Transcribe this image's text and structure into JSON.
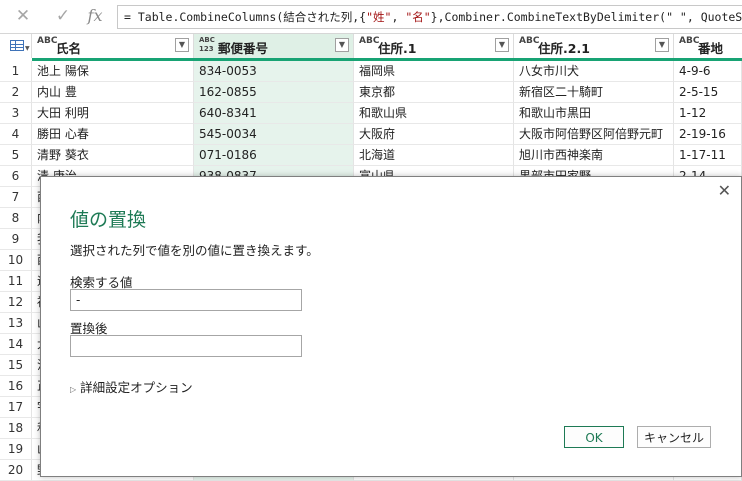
{
  "formula": {
    "prefix": "= Table.CombineColumns(結合された列,{",
    "str1": "\"姓\"",
    "sep": ", ",
    "str2": "\"名\"",
    "suffix": "},Combiner.CombineTextByDelimiter(\" \", QuoteStyle.None),\"氏名\")",
    "icons": [
      "close-icon",
      "check-icon",
      "fx-icon"
    ]
  },
  "columns": [
    {
      "type": "ABC",
      "title": "氏名"
    },
    {
      "type": "ABC 123",
      "title": "郵便番号"
    },
    {
      "type": "ABC",
      "title": "住所.1"
    },
    {
      "type": "ABC",
      "title": "住所.2.1"
    },
    {
      "type": "ABC",
      "title": "番地"
    }
  ],
  "rows": [
    {
      "n": "1",
      "c": [
        "池上 陽保",
        "834-0053",
        "福岡県",
        "八女市川犬",
        "4-9-6"
      ]
    },
    {
      "n": "2",
      "c": [
        "内山 豊",
        "162-0855",
        "東京都",
        "新宿区二十騎町",
        "2-5-15"
      ]
    },
    {
      "n": "3",
      "c": [
        "大田 利明",
        "640-8341",
        "和歌山県",
        "和歌山市黒田",
        "1-12"
      ]
    },
    {
      "n": "4",
      "c": [
        "勝田 心春",
        "545-0034",
        "大阪府",
        "大阪市阿倍野区阿倍野元町",
        "2-19-16"
      ]
    },
    {
      "n": "5",
      "c": [
        "清野 葵衣",
        "071-0186",
        "北海道",
        "旭川市西神楽南",
        "1-17-11"
      ]
    },
    {
      "n": "6",
      "c": [
        "清 康治",
        "938-0837",
        "富山県",
        "黒部市田家野",
        "2-14"
      ]
    },
    {
      "n": "7",
      "c": [
        "西",
        "",
        "",
        "",
        ""
      ]
    },
    {
      "n": "8",
      "c": [
        "内",
        "",
        "",
        "",
        ""
      ]
    },
    {
      "n": "9",
      "c": [
        "我",
        "",
        "",
        "",
        ""
      ]
    },
    {
      "n": "10",
      "c": [
        "西",
        "",
        "",
        "",
        ""
      ]
    },
    {
      "n": "11",
      "c": [
        "遠",
        "",
        "",
        "",
        ""
      ]
    },
    {
      "n": "12",
      "c": [
        "福",
        "",
        "",
        "",
        ""
      ]
    },
    {
      "n": "13",
      "c": [
        "山",
        "",
        "",
        "",
        ""
      ]
    },
    {
      "n": "14",
      "c": [
        "大",
        "",
        "",
        "",
        ""
      ]
    },
    {
      "n": "15",
      "c": [
        "浩",
        "",
        "",
        "",
        ""
      ]
    },
    {
      "n": "16",
      "c": [
        "正",
        "",
        "",
        "",
        ""
      ]
    },
    {
      "n": "17",
      "c": [
        "宇",
        "",
        "",
        "",
        ""
      ]
    },
    {
      "n": "18",
      "c": [
        "和",
        "",
        "",
        "",
        ""
      ]
    },
    {
      "n": "19",
      "c": [
        "山",
        "",
        "",
        "",
        ""
      ]
    },
    {
      "n": "20",
      "c": [
        "野",
        "",
        "",
        "",
        ""
      ]
    }
  ],
  "dialog": {
    "title": "値の置換",
    "description": "選択された列で値を別の値に置き換えます。",
    "find_label": "検索する値",
    "find_value": "-",
    "replace_label": "置換後",
    "replace_value": "",
    "advanced": "詳細設定オプション",
    "ok": "OK",
    "cancel": "キャンセル",
    "close_symbol": "✕"
  },
  "colors": {
    "accent": "#18a374",
    "dialog_title": "#1e7a55",
    "selected_column": "#e6f3ec"
  }
}
